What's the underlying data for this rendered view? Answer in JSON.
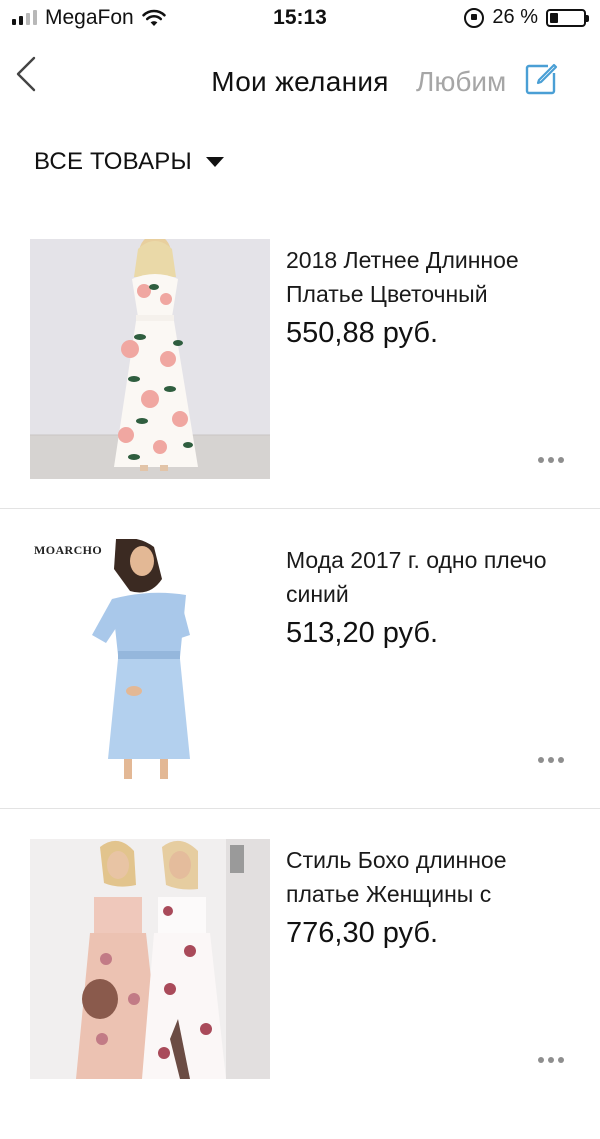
{
  "status_bar": {
    "carrier": "MegaFon",
    "time": "15:13",
    "battery": "26 %",
    "battery_level": 0.26
  },
  "nav": {
    "title": "Мои желания",
    "tab_label": "Любим"
  },
  "filter": {
    "label": "ВСЕ ТОВАРЫ"
  },
  "products": [
    {
      "title": "2018 Летнее Длинное Платье Цветочный",
      "price": "550,88 руб."
    },
    {
      "title": "Мода 2017 г. одно плечо синий",
      "price": "513,20 руб.",
      "brand": "MOARCHO"
    },
    {
      "title": "Стиль Бохо длинное платье Женщины с",
      "price": "776,30 руб."
    }
  ],
  "icons": {
    "back": "chevron-left-icon",
    "edit": "edit-square-icon",
    "more": "more-horizontal-icon",
    "filter": "caret-down-icon"
  },
  "colors": {
    "accent": "#4a9fd5",
    "muted_text": "#a6a6a6",
    "divider": "#e3e3e3"
  }
}
